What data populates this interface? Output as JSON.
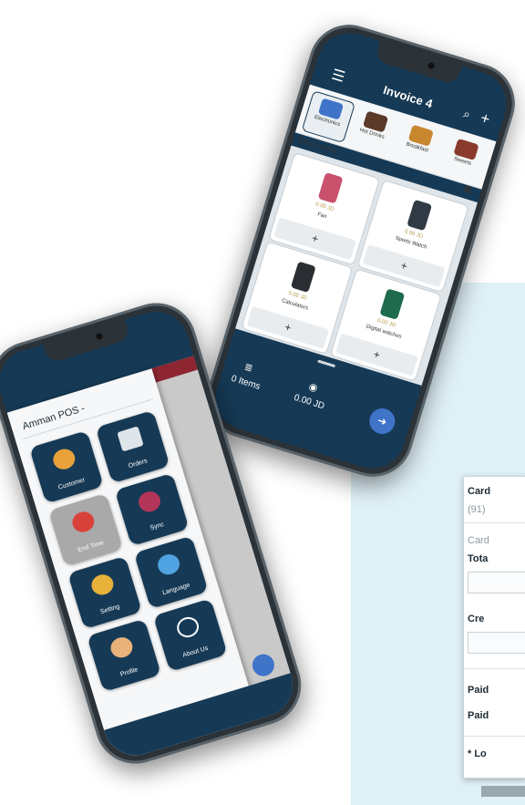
{
  "invoice_phone": {
    "title": "Invoice 4",
    "icons": {
      "menu": "hamburger-icon",
      "search": "search-icon",
      "add": "plus-icon"
    },
    "categories": [
      {
        "label": "Electronics",
        "color": "#3f74c9",
        "selected": true
      },
      {
        "label": "Hot Drinks",
        "color": "#5b3a2a",
        "selected": false
      },
      {
        "label": "Breakfast",
        "color": "#c8872f",
        "selected": false
      },
      {
        "label": "Sweets",
        "color": "#8a3b2e",
        "selected": false
      }
    ],
    "current_category": "Electronics",
    "products": [
      {
        "price": "0.00 JD",
        "name": "Fan",
        "color": "#c9516b"
      },
      {
        "price": "0.00 JD",
        "name": "Sports Watch",
        "color": "#2f3a45"
      },
      {
        "price": "0.00 JD",
        "name": "Calculators",
        "color": "#2a2e33"
      },
      {
        "price": "0.00 JD",
        "name": "Digital watches",
        "color": "#1f6b4d"
      }
    ],
    "add_label": "+",
    "items_count": "0 Items",
    "total": "0.00 JD"
  },
  "menu_phone": {
    "drawer_title": "Amman POS -",
    "tiles": [
      {
        "label": "Customer",
        "icon_color": "#e9a23b",
        "alt": false
      },
      {
        "label": "Orders",
        "icon_color": "#dfe6ea",
        "alt": false
      },
      {
        "label": "End Time",
        "icon_color": "#d8423a",
        "alt": true
      },
      {
        "label": "Sync",
        "icon_color": "#b3365a",
        "alt": false
      },
      {
        "label": "Setting",
        "icon_color": "#e6b23a",
        "alt": false
      },
      {
        "label": "Language",
        "icon_color": "#4fa3e0",
        "alt": false
      },
      {
        "label": "Profile",
        "icon_color": "#e8b27a",
        "alt": false
      },
      {
        "label": "About Us",
        "icon_color": "#163a56",
        "alt": false
      }
    ]
  },
  "background_card": {
    "row1": "Card",
    "row2": "(91)",
    "row3": "Card",
    "row4": "Tota",
    "row5": "Cre",
    "row6": "Paid",
    "row7": "Paid",
    "row8": "* Lo"
  }
}
